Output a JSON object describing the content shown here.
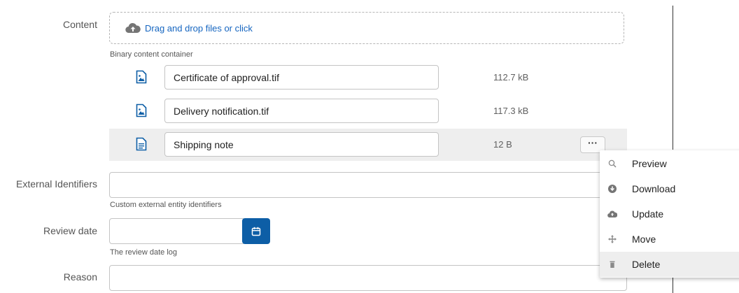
{
  "content": {
    "label": "Content",
    "dropzone_text": "Drag and drop files or click",
    "helper": "Binary content container",
    "files": [
      {
        "name": "Certificate of approval.tif",
        "size": "112.7 kB",
        "icon": "image-file-icon"
      },
      {
        "name": "Delivery notification.tif",
        "size": "117.3 kB",
        "icon": "image-file-icon"
      },
      {
        "name": "Shipping note",
        "size": "12 B",
        "icon": "text-file-icon"
      }
    ],
    "more_label": "···"
  },
  "external_identifiers": {
    "label": "External Identifiers",
    "value": "",
    "helper": "Custom external entity identifiers"
  },
  "review_date": {
    "label": "Review date",
    "value": "",
    "helper": "The review date log"
  },
  "reason": {
    "label": "Reason",
    "value": ""
  },
  "context_menu": {
    "items": [
      {
        "label": "Preview",
        "icon": "search-icon"
      },
      {
        "label": "Download",
        "icon": "download-icon"
      },
      {
        "label": "Update",
        "icon": "cloud-upload-icon"
      },
      {
        "label": "Move",
        "icon": "move-icon"
      },
      {
        "label": "Delete",
        "icon": "trash-icon"
      }
    ]
  },
  "colors": {
    "accent": "#0d5ea6",
    "link": "#1565c0",
    "row_highlight": "#eeeeee"
  }
}
